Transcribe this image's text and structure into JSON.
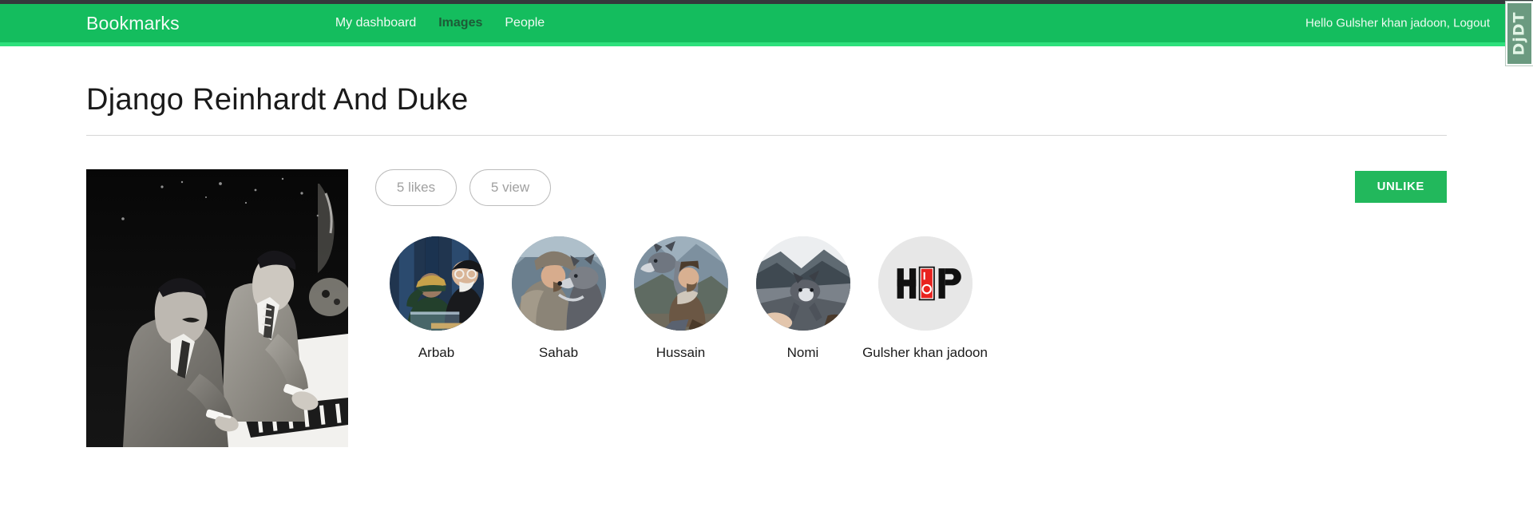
{
  "navbar": {
    "brand": "Bookmarks",
    "links": [
      {
        "label": "My dashboard",
        "active": false
      },
      {
        "label": "Images",
        "active": true
      },
      {
        "label": "People",
        "active": false
      }
    ],
    "greeting": "Hello Gulsher khan jadoon,",
    "logout_label": "Logout"
  },
  "debug_toolbar": {
    "handle_label": "DjDT"
  },
  "page": {
    "title": "Django Reinhardt And Duke"
  },
  "detail": {
    "image_alt": "Django Reinhardt And Duke",
    "likes_label": "5 likes",
    "views_label": "5 view",
    "action_button": "UNLIKE",
    "action_color": "#22b85c"
  },
  "people": [
    {
      "name": "Arbab",
      "avatar_kind": "photo-salute"
    },
    {
      "name": "Sahab",
      "avatar_kind": "photo-wolf-hug"
    },
    {
      "name": "Hussain",
      "avatar_kind": "photo-wolf-crouch"
    },
    {
      "name": "Nomi",
      "avatar_kind": "photo-wolf-run"
    },
    {
      "name": "Gulsher khan jadoon",
      "avatar_kind": "logo-hop"
    }
  ],
  "hop_logo": {
    "left_letter": "H",
    "right_letter": "P",
    "switch_color": "#e8231f"
  }
}
